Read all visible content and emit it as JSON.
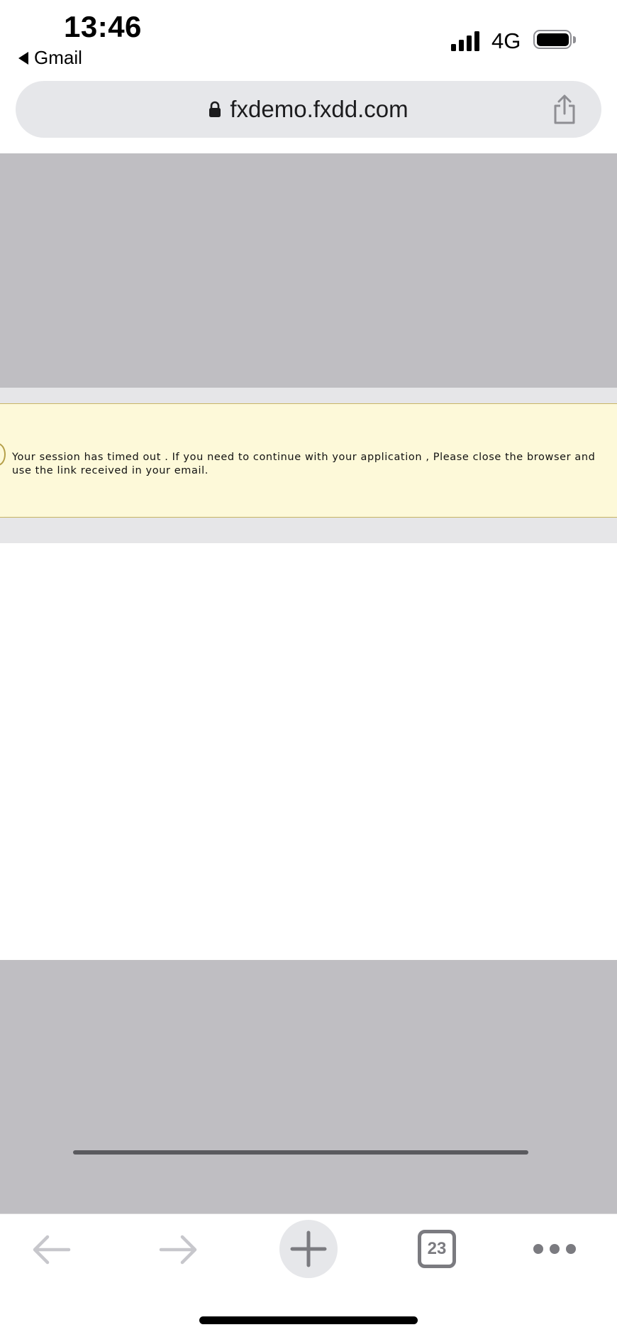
{
  "status_bar": {
    "time": "13:46",
    "back_app": "Gmail",
    "network": "4G"
  },
  "url_bar": {
    "domain": "fxdemo.fxdd.com"
  },
  "alert": {
    "message": "Your session has timed out . If you need to continue with your application , Please close the browser and use the link received in your email."
  },
  "toolbar": {
    "tabs_count": "23"
  },
  "colors": {
    "overlay_grey": "#bfbec2",
    "alert_background": "#fdf9d9",
    "alert_border": "#c8b566",
    "toolbar_icon": "#7b7b80",
    "toolbar_icon_disabled": "#c7c7cc"
  },
  "icons": {
    "signal": "cellular-signal-icon",
    "battery": "battery-icon",
    "lock": "lock-icon",
    "share": "share-icon",
    "back": "back-arrow-icon",
    "forward": "forward-arrow-icon",
    "new_tab": "plus-icon",
    "tabs": "tabs-icon",
    "more": "more-dots-icon"
  }
}
